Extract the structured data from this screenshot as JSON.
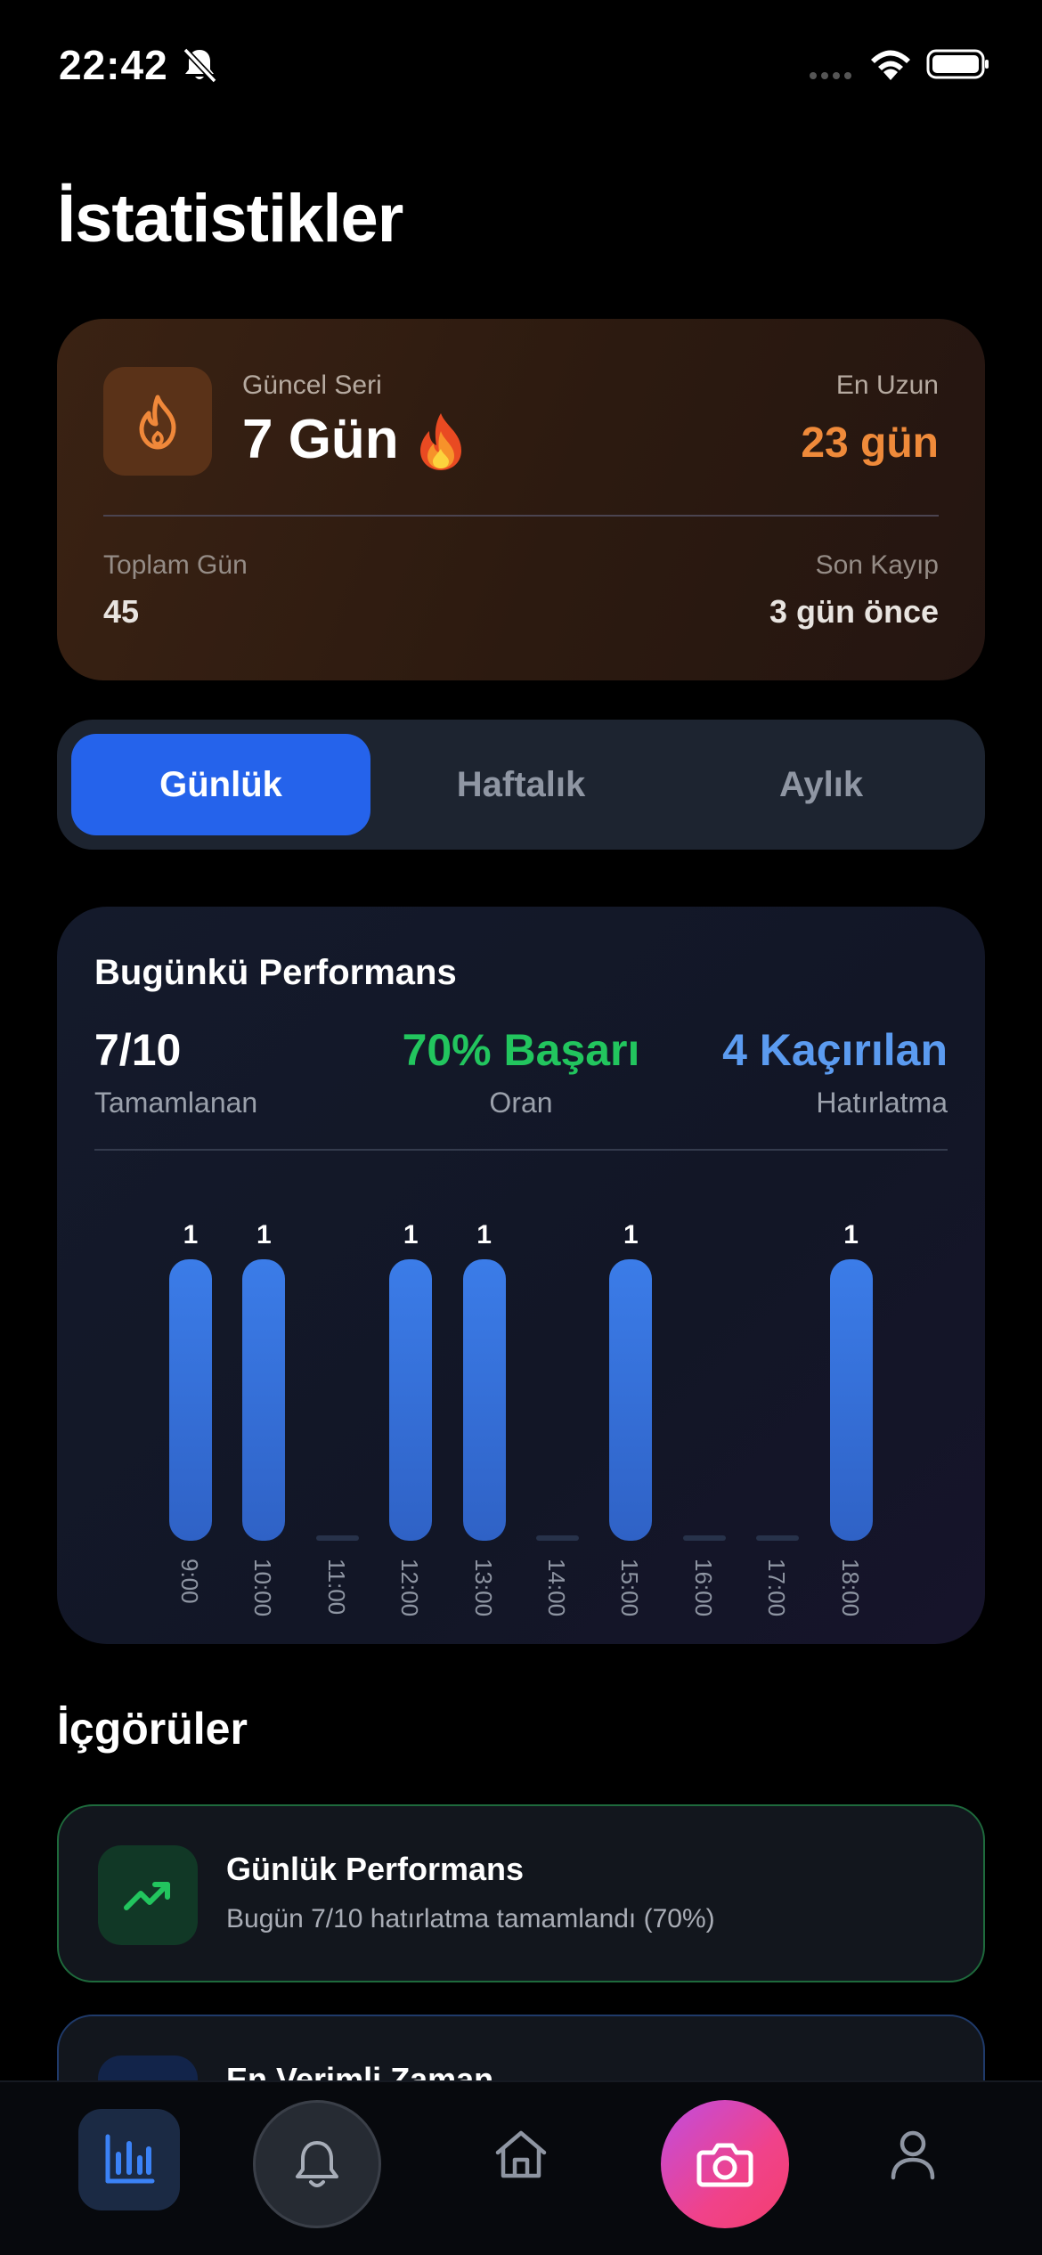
{
  "status_bar": {
    "time": "22:42"
  },
  "title": "İstatistikler",
  "streak": {
    "current_label": "Güncel Seri",
    "current_value": "7 Gün",
    "longest_label": "En Uzun",
    "longest_value": "23 gün",
    "total_days_label": "Toplam Gün",
    "total_days_value": "45",
    "last_loss_label": "Son Kayıp",
    "last_loss_value": "3 gün önce"
  },
  "tabs": [
    {
      "label": "Günlük",
      "active": true
    },
    {
      "label": "Haftalık",
      "active": false
    },
    {
      "label": "Aylık",
      "active": false
    }
  ],
  "performance": {
    "title": "Bugünkü Performans",
    "completed_value": "7/10",
    "completed_label": "Tamamlanan",
    "rate_value": "70% Başarı",
    "rate_label": "Oran",
    "missed_value": "4 Kaçırılan",
    "missed_label": "Hatırlatma"
  },
  "chart_data": {
    "type": "bar",
    "categories": [
      "9:00",
      "10:00",
      "11:00",
      "12:00",
      "13:00",
      "14:00",
      "15:00",
      "16:00",
      "17:00",
      "18:00"
    ],
    "values": [
      1,
      1,
      0,
      1,
      1,
      0,
      1,
      0,
      0,
      1
    ],
    "data_labels": [
      "1",
      "1",
      "",
      "1",
      "1",
      "",
      "1",
      "",
      "",
      "1"
    ],
    "ylim": [
      0,
      1
    ]
  },
  "insights": {
    "title": "İçgörüler",
    "items": [
      {
        "heading": "Günlük Performans",
        "description": "Bugün 7/10 hatırlatma tamamlandı (70%)",
        "icon": "trending-up-icon"
      },
      {
        "heading": "En Verimli Zaman",
        "description": "",
        "icon": "clock-icon"
      }
    ]
  },
  "nav": [
    {
      "name": "stats",
      "icon": "bar-chart-icon",
      "active": true
    },
    {
      "name": "reminders",
      "icon": "bell-icon"
    },
    {
      "name": "home",
      "icon": "home-icon"
    },
    {
      "name": "camera",
      "icon": "camera-icon"
    },
    {
      "name": "profile",
      "icon": "person-icon"
    }
  ],
  "colors": {
    "accent_blue": "#2563eb",
    "streak_orange": "#ef8a3a",
    "success_green": "#22c55e",
    "missed_blue": "#5b9bf0",
    "bar_blue": "#3b7ce8"
  }
}
